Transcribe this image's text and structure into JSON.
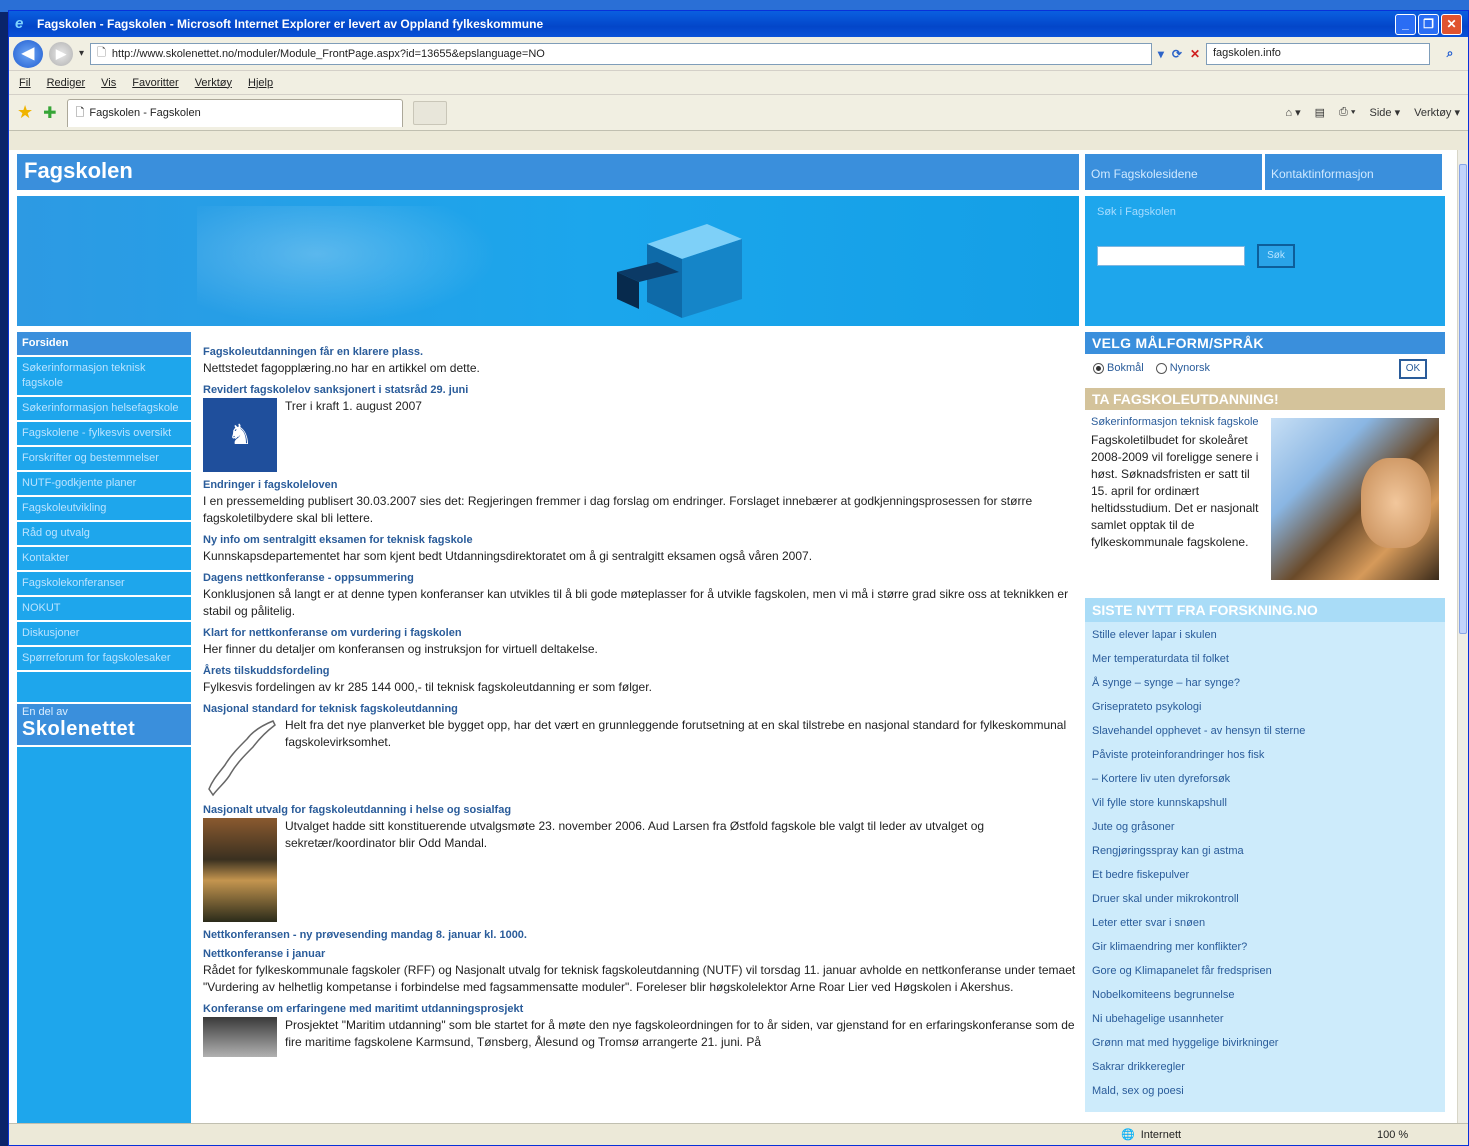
{
  "window": {
    "title": "Fagskolen - Fagskolen - Microsoft Internet Explorer er levert av Oppland fylkeskommune",
    "url": "http://www.skolenettet.no/moduler/Module_FrontPage.aspx?id=13655&epslanguage=NO",
    "search_value": "fagskolen.info",
    "menu": [
      "Fil",
      "Rediger",
      "Vis",
      "Favoritter",
      "Verktøy",
      "Hjelp"
    ],
    "tab_title": "Fagskolen - Fagskolen",
    "commands": [
      "Side ▾",
      "Verktøy ▾"
    ],
    "status_zone": "Internett",
    "zoom": "100 %"
  },
  "site": {
    "title": "Fagskolen",
    "topnav": [
      "Om Fagskolesidene",
      "Kontaktinformasjon"
    ],
    "search_label": "Søk i Fagskolen",
    "search_button": "Søk",
    "leftnav": [
      "Forsiden",
      "Søkerinformasjon teknisk fagskole",
      "Søkerinformasjon helsefagskole",
      "Fagskolene - fylkesvis oversikt",
      "Forskrifter og bestemmelser",
      "NUTF-godkjente planer",
      "Fagskoleutvikling",
      "Råd og utvalg",
      "Kontakter",
      "Fagskolekonferanser",
      "NOKUT",
      "Diskusjoner",
      "Spørreforum for fagskolesaker"
    ],
    "brand_small": "En del av",
    "brand_big": "Skolenettet"
  },
  "news": [
    {
      "h": "Fagskoleutdanningen får en klarere plass.",
      "b": "Nettstedet fagopplæring.no har en artikkel om dette."
    },
    {
      "h": "Revidert fagskolelov sanksjonert i statsråd 29. juni",
      "b": "Trer i kraft 1. august 2007"
    },
    {
      "h": "Endringer i fagskoleloven",
      "b": "I en pressemelding publisert 30.03.2007 sies det: Regjeringen fremmer i dag forslag om endringer. Forslaget innebærer at godkjenningsprosessen for større fagskoletilbydere skal bli lettere."
    },
    {
      "h": "Ny info om sentralgitt eksamen for teknisk fagskole",
      "b": "Kunnskapsdepartementet har som kjent bedt Utdanningsdirektoratet om å gi sentralgitt eksamen også våren 2007."
    },
    {
      "h": "Dagens nettkonferanse - oppsummering",
      "b": "Konklusjonen så langt er at denne typen konferanser kan utvikles til å bli gode møteplasser for å utvikle fagskolen, men vi må i større grad sikre oss at teknikken er stabil og pålitelig."
    },
    {
      "h": "Klart for nettkonferanse om vurdering i fagskolen",
      "b": "Her finner du detaljer om konferansen og instruksjon for virtuell deltakelse."
    },
    {
      "h": "Årets tilskuddsfordeling",
      "b": "Fylkesvis fordelingen av kr 285 144 000,- til teknisk fagskoleutdanning er som følger."
    },
    {
      "h": "Nasjonal standard for teknisk fagskoleutdanning",
      "b": "Helt fra det nye planverket ble bygget opp, har det vært en grunnleggende forutsetning at en skal tilstrebe en nasjonal standard for fylkeskommunal fagskolevirksomhet."
    },
    {
      "h": "Nasjonalt utvalg for fagskoleutdanning i helse og sosialfag",
      "b": "Utvalget hadde sitt konstituerende utvalgsmøte 23. november 2006. Aud Larsen fra Østfold fagskole ble valgt til leder av utvalget og sekretær/koordinator blir Odd Mandal."
    },
    {
      "h": "Nettkonferansen - ny prøvesending mandag 8. januar kl. 1000.",
      "b": ""
    },
    {
      "h": "Nettkonferanse i januar",
      "b": "Rådet for fylkeskommunale fagskoler (RFF) og Nasjonalt utvalg for teknisk fagskoleutdanning (NUTF) vil torsdag 11. januar avholde en nettkonferanse under temaet \"Vurdering av helhetlig kompetanse i forbindelse med fagsammensatte moduler\". Foreleser blir høgskolelektor Arne Roar Lier ved Høgskolen i Akershus."
    },
    {
      "h": "Konferanse om erfaringene med maritimt utdanningsprosjekt",
      "b": "Prosjektet \"Maritim utdanning\" som ble startet for å møte den nye fagskoleordningen for to år siden, var gjenstand for en erfaringskonferanse som de fire maritime fagskolene Karmsund, Tønsberg, Ålesund og Tromsø arrangerte 21. juni. På"
    }
  ],
  "right": {
    "lang_head": "VELG MÅLFORM/SPRÅK",
    "lang_options": [
      "Bokmål",
      "Nynorsk"
    ],
    "ok": "OK",
    "promo_head": "TA FAGSKOLEUTDANNING!",
    "promo_link": "Søkerinformasjon teknisk fagskole",
    "promo_text": "Fagskoletilbudet for skoleåret 2008-2009 vil foreligge senere i høst. Søknadsfristen er satt til 15. april for ordinært heltidsstudium. Det er nasjonalt samlet opptak til de fylkeskommunale fagskolene.",
    "nytt_head": "SISTE NYTT FRA FORSKNING.NO",
    "nytt": [
      "Stille elever lapar i skulen",
      "Mer temperaturdata til folket",
      "Å synge – synge – har synge?",
      "Griseprateto psykologi",
      "Slavehandel opphevet - av hensyn til sterne",
      "Påviste proteinforandringer hos fisk",
      "– Kortere liv uten dyreforsøk",
      "Vil fylle store kunnskapshull",
      "Jute og gråsoner",
      "Rengjøringsspray kan gi astma",
      "Et bedre fiskepulver",
      "Druer skal under mikrokontroll",
      "Leter etter svar i snøen",
      "Gir klimaendring mer konflikter?",
      "Gore og Klimapanelet får fredsprisen",
      "Nobelkomiteens begrunnelse",
      "Ni ubehagelige usannheter",
      "Grønn mat med hyggelige bivirkninger",
      "Sakrar drikkeregler",
      "Mald, sex og poesi"
    ]
  }
}
